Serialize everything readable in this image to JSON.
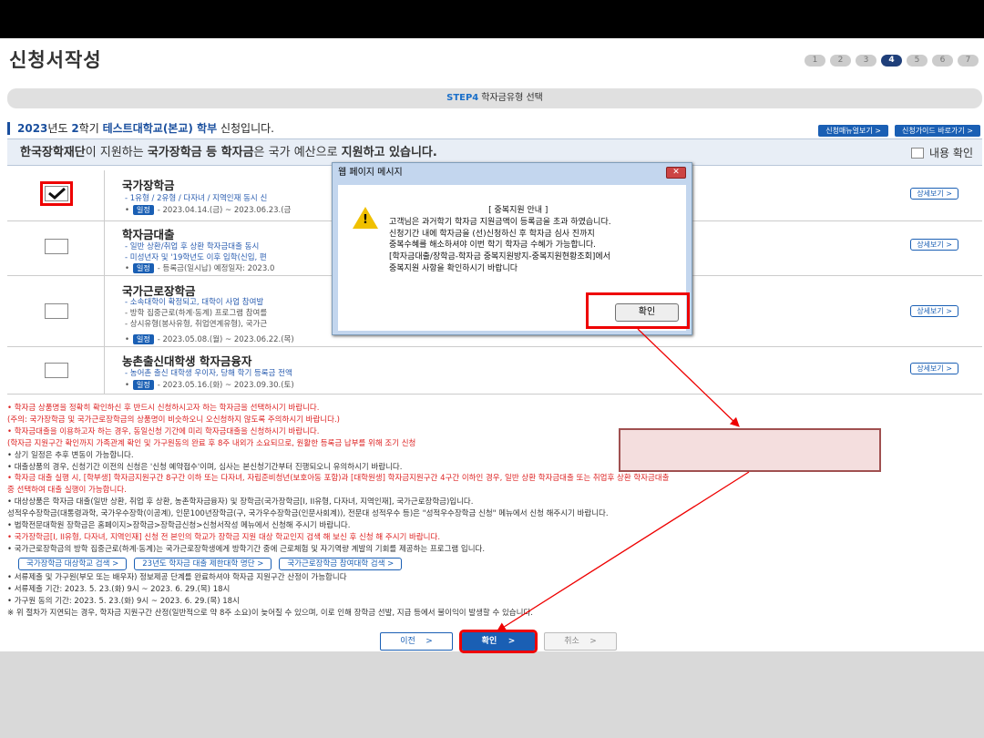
{
  "page_title": "신청서작성",
  "steps": [
    "1",
    "2",
    "3",
    "4",
    "5",
    "6",
    "7"
  ],
  "active_step_index": 3,
  "step_banner": {
    "step": "STEP4",
    "label": "학자금유형 선택"
  },
  "semester": {
    "year": "2023",
    "y_suffix": "년도 ",
    "term": "2",
    "t_suffix": "학기 ",
    "school": "테스트대학교(본교) 학부",
    "tail": " 신청입니다."
  },
  "top_buttons": {
    "manual": "신청매뉴얼보기 >",
    "guide": "신청가이드 바로가기 >"
  },
  "notice": {
    "org": "한국장학재단",
    "t1": "이 지원하는 ",
    "b1": "국가장학금 등 학자금",
    "t2": "은 국가 예산으로 ",
    "b2": "지원하고 있습니다.",
    "confirm": "내용 확인"
  },
  "schedule_tag": "일정",
  "detail_label": "상세보기 >",
  "rows": [
    {
      "title": "국가장학금",
      "sub": "- 1유형 / 2유형 / 다자녀 / 지역인재 동시 신",
      "schedule": "- 2023.04.14.(금) ~ 2023.06.23.(금"
    },
    {
      "title": "학자금대출",
      "sub": "- 일반 상환/취업 후 상환 학자금대출 동시",
      "sub2": "- 미성년자 및 '19학년도 이후 입학(신입, 편",
      "schedule": "- 등록금(일시납) 예정일자: 2023.0"
    },
    {
      "title": "국가근로장학금",
      "sub": "- 소속대학이 확정되고, 대학이 사업 참여발",
      "gray1": "- 방학 집중근로(하계·동계) 프로그램 참여를",
      "gray2": "- 상시유형(봉사유형, 취업연계유형), 국가근",
      "schedule": "- 2023.05.08.(월) ~ 2023.06.22.(목)"
    },
    {
      "title": "농촌출신대학생 학자금융자",
      "sub": "- 농어촌 출신 대학생 우이자, 당해 학기 등록금 전액",
      "schedule": "- 2023.05.16.(화) ~ 2023.09.30.(토)"
    }
  ],
  "notes": [
    {
      "t": "• 학자금 상품명을 정확히 확인하신 후 반드시 신청하시고자 하는 학자금을 선택하시기 바랍니다.",
      "red": true
    },
    {
      "t": "  (주의: 국가장학금 및 국가근로장학금의 상품명이 비슷하오니 오신청하지 않도록 주의하시기 바랍니다.)",
      "red": true
    },
    {
      "t": "• 학자금대출을 이용하고자 하는 경우, 동일신청 기간에 미리 학자금대출을 신청하시기 바랍니다.",
      "red": true
    },
    {
      "t": "  (학자금 지원구간 확인까지 가족관계 확인 및 가구원동의 완료 후 8주 내외가 소요되므로, 원활한 등록금 납부를 위해 조기 신청",
      "red": true
    },
    {
      "t": "• 상기 일정은 추후 변동이 가능합니다.",
      "red": false
    },
    {
      "t": "• 대출상품의 경우, 신청기간 이전의 신청은 '신청 예약접수'이며, 심사는 본신청기간부터 진행되오니 유의하시기 바랍니다.",
      "red": false
    },
    {
      "t": "• 학자금 대출 실행 시, [학부생] 학자금지원구간 8구간 이하 또는 다자녀, 자립준비청년(보호아동 포함)과 [대학원생] 학자금지원구간 4구간 이하인 경우, 일반 상환 학자금대출 또는 취업후 상환 학자금대출",
      "red": true
    },
    {
      "t": "  중 선택하여 대출 실행이 가능합니다.",
      "red": true
    },
    {
      "t": "• 대상상품은 학자금 대출(일반 상환, 취업 후 상환, 농촌학자금융자) 및 장학금(국가장학금[I, II유형, 다자녀, 지역인재], 국가근로장학금)입니다.",
      "red": false
    },
    {
      "t": "  성적우수장학금(대통령과학, 국가우수장학(이공계), 인문100년장학금(구, 국가우수장학금(인문사회계)), 전문대 성적우수 등)은 \"성적우수장학금 신청\" 메뉴에서 신청 해주시기 바랍니다.",
      "red": false
    },
    {
      "t": "• 법학전문대학원 장학금은 홈페이지>장학금>장학금신청>신청서작성 메뉴에서 신청해 주시기 바랍니다.",
      "red": false
    },
    {
      "t": "• 국가장학금[I, II유형, 다자녀, 지역인재] 신청 전 본인의 학교가 장학금 지원 대상 학교인지 검색 해 보신 후 신청 해 주시기 바랍니다.",
      "red": true
    },
    {
      "t": "• 국가근로장학금의 방학 집중근로(하계·동계)는 국가근로장학생에게 방학기간 중에 근로체험 및 자기역량 계발의 기회를 제공하는 프로그램 입니다.",
      "red": false
    }
  ],
  "link_buttons": [
    "국가장학금 대상학교 검색 >",
    "23년도 학자금 대출 제한대학 명단 >",
    "국가근로장학금 참여대학 검색 >"
  ],
  "notes2": [
    "• 서류제출 및 가구원(부모 또는 배우자) 정보제공 단계를 완료하셔야 학자금 지원구간 산정이 가능합니다",
    "• 서류제출 기간: 2023. 5. 23.(화) 9시 ~ 2023. 6. 29.(목) 18시",
    "• 가구원 동의 기간: 2023. 5. 23.(화) 9시 ~ 2023. 6. 29.(목) 18시",
    "  ※ 위 절차가 지연되는 경우, 학자금 지원구간 산정(일반적으로 약 8주 소요)이 늦어질 수 있으며, 이로 인해 장학금 선발, 지급 등에서 불이익이 발생할 수 있습니다."
  ],
  "bottom_buttons": {
    "prev": "이전",
    "ok": "확인",
    "cancel": "취소",
    "arrow": ">"
  },
  "dialog": {
    "title": "웹 페이지 메시지",
    "close": "✕",
    "heading": "[ 중복지원 안내 ]",
    "lines": [
      "고객님은 과거학기 학자금 지원금액이 등록금을 초과 하였습니다.",
      "신청기간 내에 학자금을 (선)신청하신 후 학자금 심사 진까지",
      "중복수혜를 해소하셔야 이번 학기 학자금 수혜가 가능합니다.",
      "[학자금대출/장학금-학자금 중복지원방지-중복지원현황조회]에서",
      "중복지원 사항을 확인하시기 바랍니다"
    ],
    "ok": "확인"
  },
  "colors": {
    "accent": "#1a5fb4",
    "highlight": "#ee0000",
    "topbar": "#000000"
  }
}
